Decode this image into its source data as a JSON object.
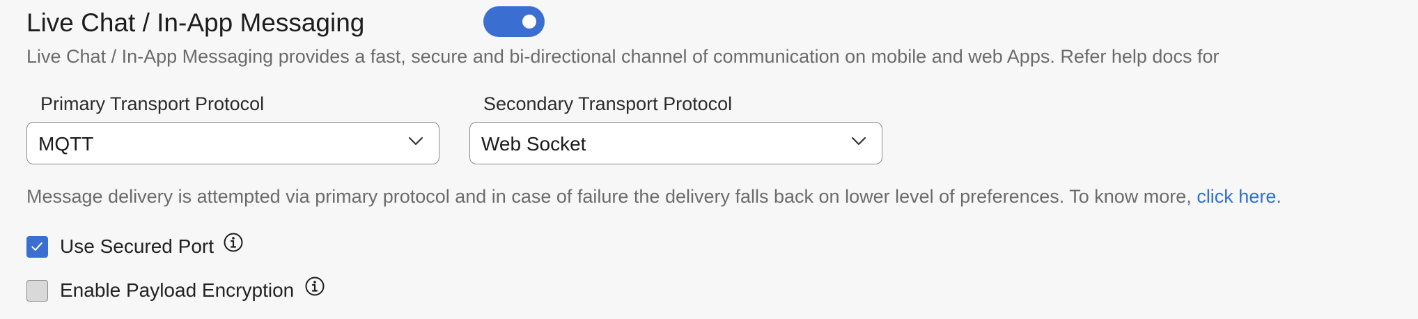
{
  "section": {
    "title": "Live Chat / In-App Messaging",
    "enabled": true,
    "description": "Live Chat / In-App Messaging provides a fast, secure and bi-directional channel of communication on mobile and web Apps. Refer help docs for"
  },
  "primary_protocol": {
    "label": "Primary Transport Protocol",
    "value": "MQTT",
    "icon": "chevron-down-icon"
  },
  "secondary_protocol": {
    "label": "Secondary Transport Protocol",
    "value": "Web Socket",
    "icon": "chevron-down-icon"
  },
  "delivery_note": {
    "text": "Message delivery is attempted via primary protocol and in case of failure the delivery falls back on lower level of preferences. To know more, ",
    "link_text": "click here."
  },
  "options": {
    "secured_port": {
      "label": "Use Secured Port",
      "checked": true,
      "icon": "info-icon"
    },
    "payload_encryption": {
      "label": "Enable Payload Encryption",
      "checked": false,
      "icon": "info-icon"
    }
  },
  "colors": {
    "accent": "#3a6fd1",
    "link": "#2f6fd6",
    "muted_text": "#6b6b6b",
    "background": "#f7f7f7"
  }
}
